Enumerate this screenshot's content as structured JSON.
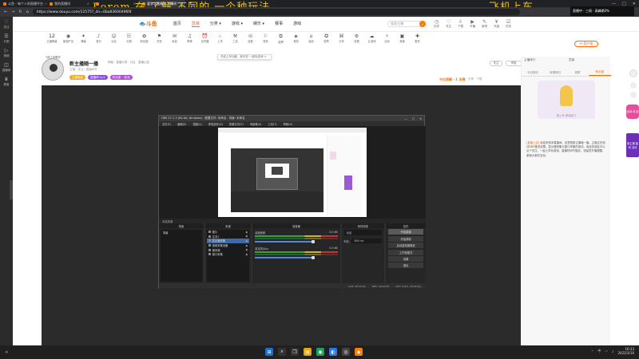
{
  "browser": {
    "tabs": [
      {
        "label": "斗鱼 - 每个人的直播平台",
        "active": false
      },
      {
        "label": "我的直播间",
        "active": false
      },
      {
        "label": "",
        "active": false
      },
      {
        "label": "爱学字直播间 直播间",
        "active": true
      }
    ],
    "overlay_left": "Lorem 在 了解 不同的 一个种玩法",
    "overlay_right": "飞机上车",
    "url": "https://www.douyu.com/12575?_dn=0ba83600496f4",
    "toast": "直播中 · 三网 · 高峰期3%"
  },
  "left_sidebar": [
    {
      "icon": "♡",
      "label": "关注"
    },
    {
      "icon": "☰",
      "label": "分类"
    },
    {
      "icon": "▷",
      "label": "视频"
    },
    {
      "icon": "◫",
      "label": "直播间"
    },
    {
      "icon": "♛",
      "label": "赛事"
    }
  ],
  "site": {
    "logo": "🐟斗鱼",
    "nav": [
      "首页",
      "直播",
      "分类 ▾",
      "游戏 ▾",
      "娱乐 ▾",
      "赛事",
      "游戏"
    ],
    "nav_active_index": 1,
    "search_placeholder": "搜索主播",
    "nav_icons": [
      "历史",
      "关注",
      "下载",
      "开播",
      "鱼吧",
      "充值",
      "任务"
    ],
    "categories": [
      {
        "g": "12",
        "label": "主播等级"
      },
      {
        "g": "◉",
        "label": "鱼翅产出"
      },
      {
        "g": "✦",
        "label": "弹幕"
      },
      {
        "g": "♪",
        "label": "音乐"
      },
      {
        "g": "☺",
        "label": "水友"
      },
      {
        "g": "☷",
        "label": "礼物"
      },
      {
        "g": "✿",
        "label": "粉丝团"
      },
      {
        "g": "⚑",
        "label": "任务"
      },
      {
        "g": "✉",
        "label": "私信"
      },
      {
        "g": "♫",
        "label": "歌单"
      },
      {
        "g": "⏰",
        "label": "定时器"
      },
      {
        "g": "♘",
        "label": "上车"
      },
      {
        "g": "⚒",
        "label": "工具"
      },
      {
        "g": "☏",
        "label": "连麦"
      },
      {
        "g": "⚐",
        "label": "签到"
      },
      {
        "g": "⧉",
        "label": "投票"
      },
      {
        "g": "◈",
        "label": "竞猜"
      },
      {
        "g": "⌂",
        "label": "装扮"
      },
      {
        "g": "✪",
        "label": "勋章"
      },
      {
        "g": "⌘",
        "label": "分享"
      },
      {
        "g": "⚙",
        "label": "设置"
      },
      {
        "g": "☁",
        "label": "云游戏"
      },
      {
        "g": "⚡",
        "label": "活动"
      },
      {
        "g": "▣",
        "label": "录像"
      },
      {
        "g": "✚",
        "label": "更多"
      }
    ],
    "pc_button": "PC客户端",
    "tooltip": "开启上车功能，即可在·一起玩游戏 ×"
  },
  "room": {
    "avatar_name": "飞机上车教学",
    "title": "新主播随一播",
    "tag": "神秘 · 直播分类 · 分区 · 直播公告",
    "sub": "主播 · 关注 · 直播间号",
    "badges": [
      "主播等级",
      "直播间 Lv.1",
      "粉丝团 一起玩"
    ],
    "rank": "今日贡献 · 1 无榜",
    "rank_meta": "分享 · 下载",
    "follow": "关注",
    "follow2": "举报"
  },
  "obs": {
    "title": "OBS 27.1.3 (64-bit, windows) - 配置文件: 未命名 - 场景: 未命名",
    "menu": [
      "文件(F)",
      "编辑(E)",
      "视图(V)",
      "停靠部件(D)",
      "配置文件(P)",
      "场景集(S)",
      "工具(T)",
      "帮助(H)"
    ],
    "scenebar": "未选择源",
    "docks": {
      "scenes": "场景",
      "sources": "来源",
      "mixer": "混音器",
      "transitions": "转场特效",
      "controls": "控件"
    },
    "scenes": [
      "场景"
    ],
    "sources": [
      {
        "label": "图片",
        "selected": false
      },
      {
        "label": "文本1",
        "selected": false
      },
      {
        "label": "显示器采集",
        "selected": true
      },
      {
        "label": "视频采集设备",
        "selected": false
      },
      {
        "label": "媒体源",
        "selected": false
      },
      {
        "label": "窗口采集",
        "selected": false
      }
    ],
    "mixer": [
      {
        "name": "桌面音频",
        "db": "0.0 dB"
      },
      {
        "name": "麦克风/Aux",
        "db": "0.0 dB"
      }
    ],
    "transition_type": "淡出",
    "duration_label": "时长",
    "duration_value": "300 ms",
    "controls": [
      "开始直播",
      "开始录制",
      "启动虚拟摄像机",
      "工作室模式",
      "设置",
      "退出"
    ],
    "status": [
      "LIVE: 00:00:00",
      "REC: 00:00:00",
      "CPU: 0.8%, 30.00 fps"
    ]
  },
  "right_panel": {
    "top_left": "主播排行",
    "top_right": "贡献",
    "tabs": [
      "今日排行",
      "本周排行",
      "贵宾",
      "粉丝团"
    ],
    "active_tab": 3,
    "art_caption": "快上车 即将起飞",
    "notice_label": "[直播公告]",
    "notice": "欢迎来到本直播间，这里是新主播随一播。主播正在测试OBS推流设置，显示器采集与窗口采集的用法。喜欢的朋友可以点个关注，一起上车玩游戏。直播时间不固定，请留意开播提醒，谢谢大家的支持。",
    "promo1": "活动 礼包",
    "promo2": "新主播 福利 活动"
  },
  "taskbar": {
    "time": "16:33",
    "date": "2022/3/16",
    "lang": "中"
  }
}
